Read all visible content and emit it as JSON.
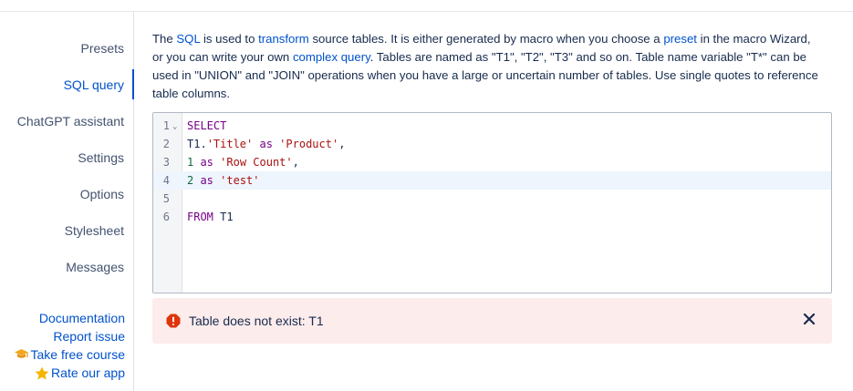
{
  "nav": {
    "presets": "Presets",
    "sql_query": "SQL query",
    "chatgpt": "ChatGPT assistant",
    "settings": "Settings",
    "options": "Options",
    "stylesheet": "Stylesheet",
    "messages": "Messages"
  },
  "links": {
    "documentation": "Documentation",
    "report_issue": "Report issue",
    "take_course": "Take free course",
    "rate_app": "Rate our app"
  },
  "description": {
    "p1": "The ",
    "sql": "SQL",
    "p2": " is used to ",
    "transform": "transform",
    "p3": " source tables. It is either generated by macro when you choose a ",
    "preset": "preset",
    "p4": " in the macro Wizard, or you can write your own ",
    "complex_query": "complex query",
    "p5": ". Tables are named as \"T1\", \"T2\", \"T3\" and so on. Table name variable \"T*\" can be used in \"UNION\" and \"JOIN\" operations when you have a large or uncertain number of tables. Use single quotes to reference table columns."
  },
  "editor": {
    "line_numbers": [
      "1",
      "2",
      "3",
      "4",
      "5",
      "6"
    ],
    "l1_kw": "SELECT",
    "l2_a": "T1.",
    "l2_str1": "'Title'",
    "l2_kw": " as ",
    "l2_str2": "'Product'",
    "l2_end": ",",
    "l3_num": "1",
    "l3_kw": " as ",
    "l3_str": "'Row Count'",
    "l3_end": ",",
    "l4_num": "2",
    "l4_kw": " as ",
    "l4_str": "'test'",
    "l6_kw": "FROM",
    "l6_rest": " T1"
  },
  "alert": {
    "message": "Table does not exist: T1",
    "icon": "error-icon",
    "color": "#de350b",
    "background": "#fdecec"
  },
  "colors": {
    "accent": "#0052cc",
    "keyword": "#770088",
    "string": "#aa1111",
    "number": "#116644"
  }
}
